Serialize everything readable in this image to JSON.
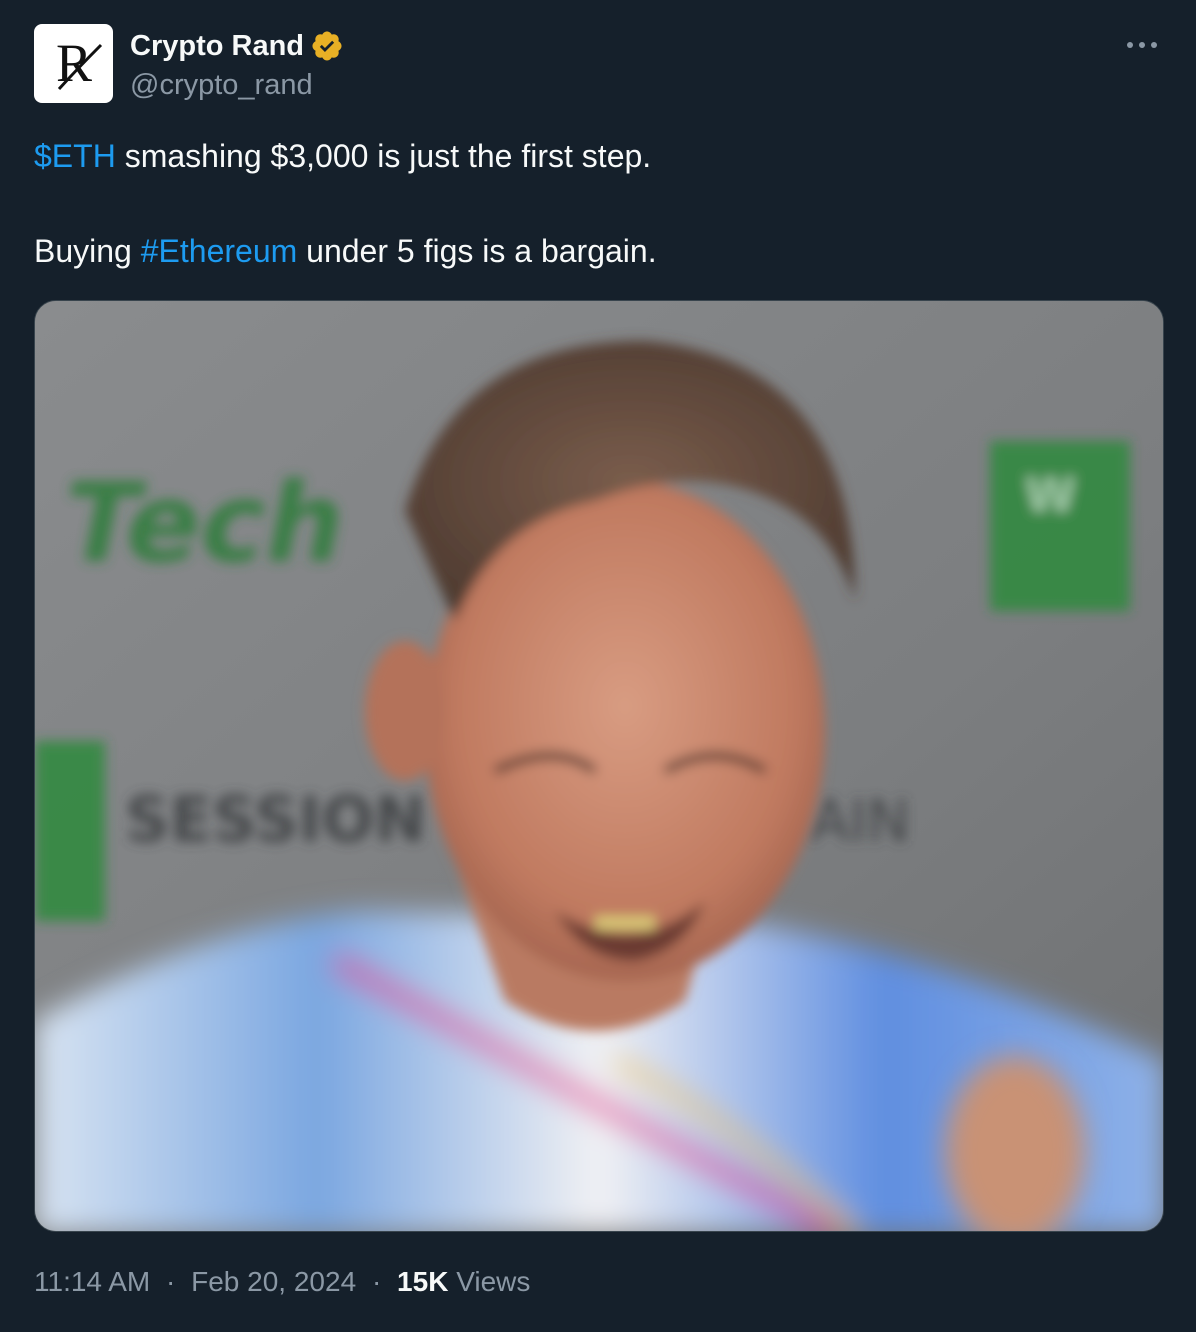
{
  "author": {
    "name": "Crypto Rand",
    "handle": "@crypto_rand",
    "avatar_letter": "R",
    "verified_color": "#e8b025"
  },
  "tweet": {
    "line1": {
      "cashtag": "$ETH",
      "rest": " smashing $3,000 is just the first step."
    },
    "line2": {
      "before": "Buying ",
      "hashtag": "#Ethereum",
      "after": " under 5 figs is a bargain."
    }
  },
  "media": {
    "backdrop_text_1": "Tech",
    "backdrop_text_2": "SESSION",
    "backdrop_text_3": "AIN",
    "backdrop_text_4": "W"
  },
  "footer": {
    "time": "11:14 AM",
    "date": "Feb 20, 2024",
    "separator": "·",
    "views_count": "15K",
    "views_label": "Views"
  },
  "icons": {
    "more": "more-horizontal-icon",
    "verified": "verified-badge-icon"
  },
  "colors": {
    "background": "#15202b",
    "link": "#1d9bf0",
    "muted": "#8b98a5"
  }
}
